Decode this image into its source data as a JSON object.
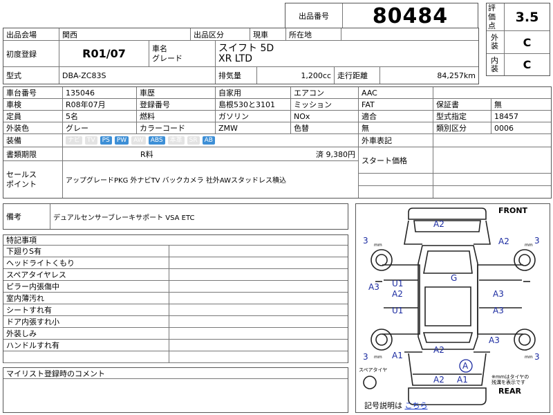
{
  "lot": {
    "label": "出品番号",
    "number": "80484"
  },
  "rating": {
    "label": "評価点",
    "value": "3.5",
    "exterior_label": "外装",
    "exterior": "C",
    "interior_label": "内装",
    "interior": "C"
  },
  "venue": {
    "label": "出品会場",
    "value": "関西"
  },
  "category": {
    "label": "出品区分",
    "value": "現車",
    "location_label": "所在地",
    "location": ""
  },
  "first_reg": {
    "label": "初度登録",
    "value": "R01/07"
  },
  "car": {
    "name_label": "車名",
    "grade_label": "グレード",
    "name": "スイフト 5D",
    "grade": "XR LTD"
  },
  "model": {
    "label": "型式",
    "value": "DBA-ZC83S"
  },
  "displacement": {
    "label": "排気量",
    "value": "1,200cc"
  },
  "mileage": {
    "label": "走行距離",
    "value": "84,257km"
  },
  "rows": [
    [
      "車台番号",
      "135046",
      "車歴",
      "自家用",
      "エアコン",
      "AAC"
    ],
    [
      "車検",
      "R08年07月",
      "登録番号",
      "島根530と3101",
      "ミッション",
      "FAT"
    ],
    [
      "定員",
      "5名",
      "燃料",
      "ガソリン",
      "NOx",
      "適合"
    ],
    [
      "外装色",
      "グレー",
      "カラーコード",
      "ZMW",
      "色替",
      "無"
    ]
  ],
  "right_rows": [
    [
      "保証書",
      "無"
    ],
    [
      "型式指定",
      "18457"
    ],
    [
      "類別区分",
      "0006"
    ]
  ],
  "equipment": {
    "label": "装備",
    "items": [
      {
        "name": "ナビ",
        "on": false
      },
      {
        "name": "TV",
        "on": false
      },
      {
        "name": "PS",
        "on": true
      },
      {
        "name": "PW",
        "on": true
      },
      {
        "name": "AW",
        "on": false
      },
      {
        "name": "ABS",
        "on": true
      },
      {
        "name": "本革",
        "on": false
      },
      {
        "name": "SR",
        "on": false
      },
      {
        "name": "AB",
        "on": true
      }
    ]
  },
  "import_label": "外車表記",
  "docs": {
    "label": "書類期限",
    "value": "R料",
    "tax": "済 9,380円"
  },
  "start_price": {
    "label": "スタート価格",
    "value": ""
  },
  "sales": {
    "label1": "セールス",
    "label2": "ポイント",
    "value": "アップグレードPKG 外ナビTV バックカメラ 社外AWスタッドレス積込"
  },
  "remarks": {
    "label": "備考",
    "value": "デュアルセンサーブレーキサポート VSA ETC"
  },
  "special": {
    "label": "特記事項",
    "items": [
      "下廻りS有",
      "ヘッドライトくもり",
      "スペアタイヤレス",
      "ピラー内張傷中",
      "室内薄汚れ",
      "シートすれ有",
      "ドア内張すれ小",
      "外装しみ",
      "ハンドルすれ有",
      ""
    ]
  },
  "mylist": {
    "label": "マイリスト登録時のコメント",
    "value": ""
  },
  "diagram": {
    "front": "FRONT",
    "rear": "REAR",
    "spare": "スペアタイヤ",
    "note_line1": "※mmはタイヤの",
    "note_line2": "残溝を表示です",
    "legend_label": "記号説明は",
    "legend_link": "こちら",
    "tire_mark": "3",
    "tire_unit": "mm",
    "marks": {
      "a2_top": "A2",
      "a2_right": "A2",
      "g": "G",
      "u1_a": "U1",
      "a2_mid": "A2",
      "u1_b": "U1",
      "a3_left": "A3",
      "a3_right1": "A3",
      "a3_right2": "A3",
      "a3_right3": "A3",
      "a2_bottom": "A2",
      "a1_left": "A1",
      "a_circle": "A",
      "a2_rear": "A2",
      "a1_rear": "A1"
    }
  }
}
